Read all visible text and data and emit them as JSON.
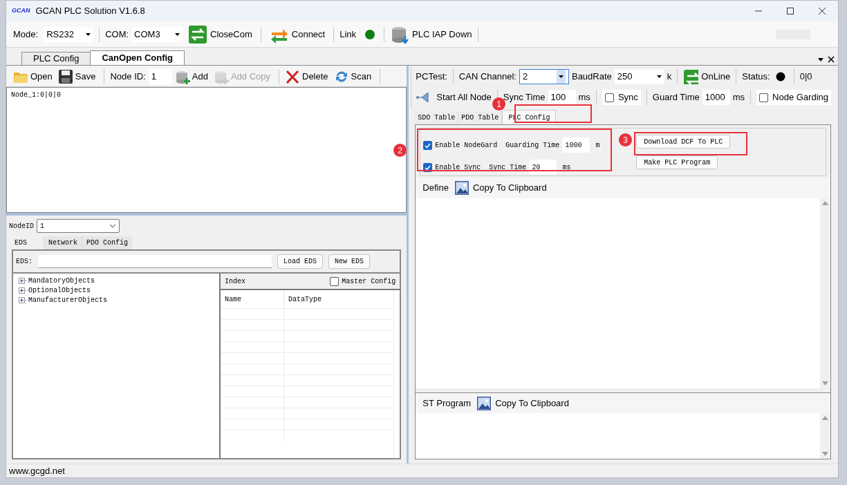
{
  "window": {
    "title": "GCAN PLC Solution V1.6.8",
    "logo": "GCAN"
  },
  "toolbar": {
    "mode": {
      "label": "Mode:",
      "value": "RS232"
    },
    "com": {
      "label": "COM:",
      "value": "COM3"
    },
    "buttons": [
      {
        "kind": "close",
        "label": "CloseCom"
      },
      {
        "kind": "connect",
        "label": "Connect"
      }
    ],
    "link": {
      "label": "Link",
      "on": true
    },
    "iap": {
      "label": "PLC IAP Down"
    }
  },
  "main_tabs": [
    {
      "label": "PLC Config",
      "selected": false
    },
    {
      "label": "CanOpen Config",
      "selected": true
    }
  ],
  "left": {
    "toolbar": [
      {
        "kind": "open",
        "label": "Open",
        "disabled": false
      },
      {
        "kind": "save",
        "label": "Save",
        "disabled": false
      },
      {
        "kind": "nodeid",
        "label": "Node ID:",
        "value": "1"
      },
      {
        "kind": "add",
        "label": "Add",
        "disabled": false
      },
      {
        "kind": "add",
        "label": "Add Copy",
        "disabled": true
      },
      {
        "kind": "delete",
        "label": "Delete",
        "disabled": false
      },
      {
        "kind": "scan",
        "label": "Scan",
        "disabled": false
      }
    ],
    "nodes": [
      "Node_1:0|0|0"
    ],
    "node_select": {
      "label": "NodeID",
      "value": "1"
    },
    "sub_tabs": [
      {
        "label": "EDS",
        "selected": true
      },
      {
        "label": "Network",
        "selected": false
      },
      {
        "label": "PDO Config",
        "selected": false
      }
    ],
    "eds": {
      "label": "EDS:",
      "buttons": [
        "Load EDS",
        "New EDS"
      ]
    },
    "tree": [
      {
        "label": "MandatoryObjects",
        "expanded": false
      },
      {
        "label": "OptionalObjects",
        "expanded": false
      },
      {
        "label": "ManufacturerObjects",
        "expanded": false
      }
    ],
    "table": {
      "title": "Index",
      "master_config": {
        "label": "Master Config",
        "checked": false
      },
      "columns": [
        "Name",
        "DataType"
      ]
    }
  },
  "right": {
    "pctest": {
      "label": "PCTest:",
      "channel": {
        "label": "CAN Channel:",
        "value": "2"
      },
      "baud": {
        "label": "BaudRate",
        "value": "250",
        "unit": "k"
      },
      "online": "OnLine",
      "status": {
        "label": "Status:",
        "active": false,
        "value": "0|0"
      }
    },
    "node_bar": {
      "start": "Start All Node",
      "sync_time": {
        "label": "Sync Time",
        "value": "100",
        "unit": "ms"
      },
      "sync": {
        "label": "Sync",
        "checked": false
      },
      "guard_time": {
        "label": "Guard Time",
        "value": "1000",
        "unit": "ms"
      },
      "node_garding": {
        "label": "Node Garding",
        "checked": false
      }
    },
    "tabs": [
      {
        "label": "SDO Table",
        "selected": false
      },
      {
        "label": "PDO Table",
        "selected": false
      },
      {
        "label": "PLC Config",
        "selected": true
      }
    ],
    "plc_config": {
      "rows": [
        {
          "label": "Enable NodeGard",
          "checked": true,
          "field_label": "Guarding Time",
          "value": "1000",
          "unit": "m"
        },
        {
          "label": "Enable Sync",
          "checked": true,
          "field_label": "Sync Time",
          "value": "20",
          "unit": "ms"
        }
      ],
      "buttons": [
        "Download DCF To PLC",
        "Make PLC Program"
      ]
    },
    "sections": [
      {
        "label": "Define",
        "button": "Copy To Clipboard"
      },
      {
        "label": "ST Program",
        "button": "Copy To Clipboard"
      }
    ]
  },
  "annotations": [
    "1",
    "2",
    "3"
  ],
  "status_bar": "www.gcgd.net"
}
